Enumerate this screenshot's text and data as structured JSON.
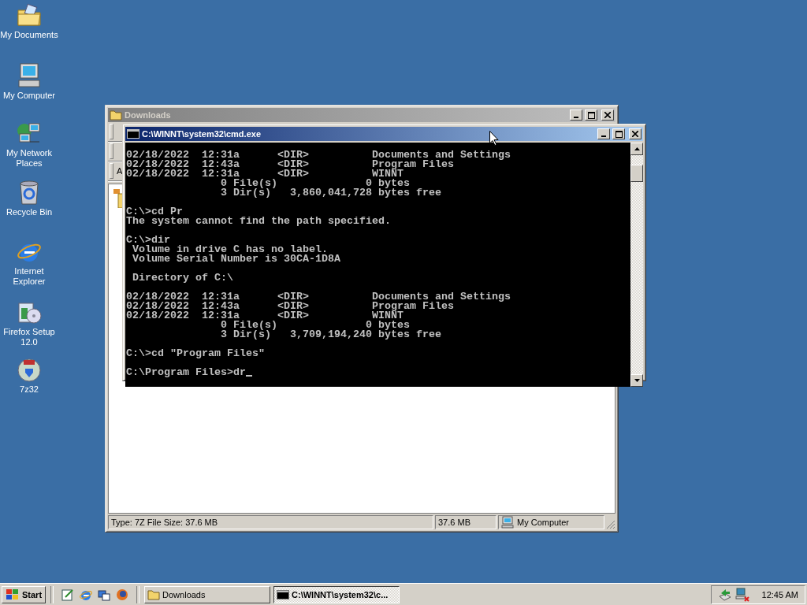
{
  "desktop_icons": [
    {
      "label": "My Documents",
      "kind": "documents"
    },
    {
      "label": "My Computer",
      "kind": "computer"
    },
    {
      "label": "My Network Places",
      "kind": "network"
    },
    {
      "label": "Recycle Bin",
      "kind": "bin"
    },
    {
      "label": "Internet Explorer",
      "kind": "browser"
    },
    {
      "label": "Firefox Setup 12.0",
      "kind": "installer"
    },
    {
      "label": "7z32",
      "kind": "archive"
    }
  ],
  "explorer": {
    "title": "Downloads",
    "toolbar_letter": "A",
    "status_bar": [
      "Type: 7Z File Size: 37.6 MB",
      "37.6 MB",
      "My Computer"
    ]
  },
  "console": {
    "title": "C:\\WINNT\\system32\\cmd.exe",
    "blocks": [
      [
        "02/18/2022  12:31a      <DIR>          Documents and Settings",
        "02/18/2022  12:43a      <DIR>          Program Files",
        "02/18/2022  12:31a      <DIR>          WINNT",
        "               0 File(s)              0 bytes",
        "               3 Dir(s)   3,860,041,728 bytes free"
      ],
      [
        "C:\\>cd Pr",
        "The system cannot find the path specified."
      ],
      [
        "C:\\>dir",
        " Volume in drive C has no label.",
        " Volume Serial Number is 30CA-1D8A"
      ],
      [
        " Directory of C:\\"
      ],
      [
        "02/18/2022  12:31a      <DIR>          Documents and Settings",
        "02/18/2022  12:43a      <DIR>          Program Files",
        "02/18/2022  12:31a      <DIR>          WINNT",
        "               0 File(s)              0 bytes",
        "               3 Dir(s)   3,709,194,240 bytes free"
      ],
      [
        "C:\\>cd \"Program Files\""
      ]
    ],
    "prompt": "C:\\Program Files>dr"
  },
  "taskbar": {
    "start": "Start",
    "tasks": [
      {
        "label": "Downloads",
        "kind": "folder",
        "selected": false
      },
      {
        "label": "C:\\WINNT\\system32\\c...",
        "kind": "console",
        "selected": true
      }
    ],
    "clock": "12:45 AM"
  }
}
